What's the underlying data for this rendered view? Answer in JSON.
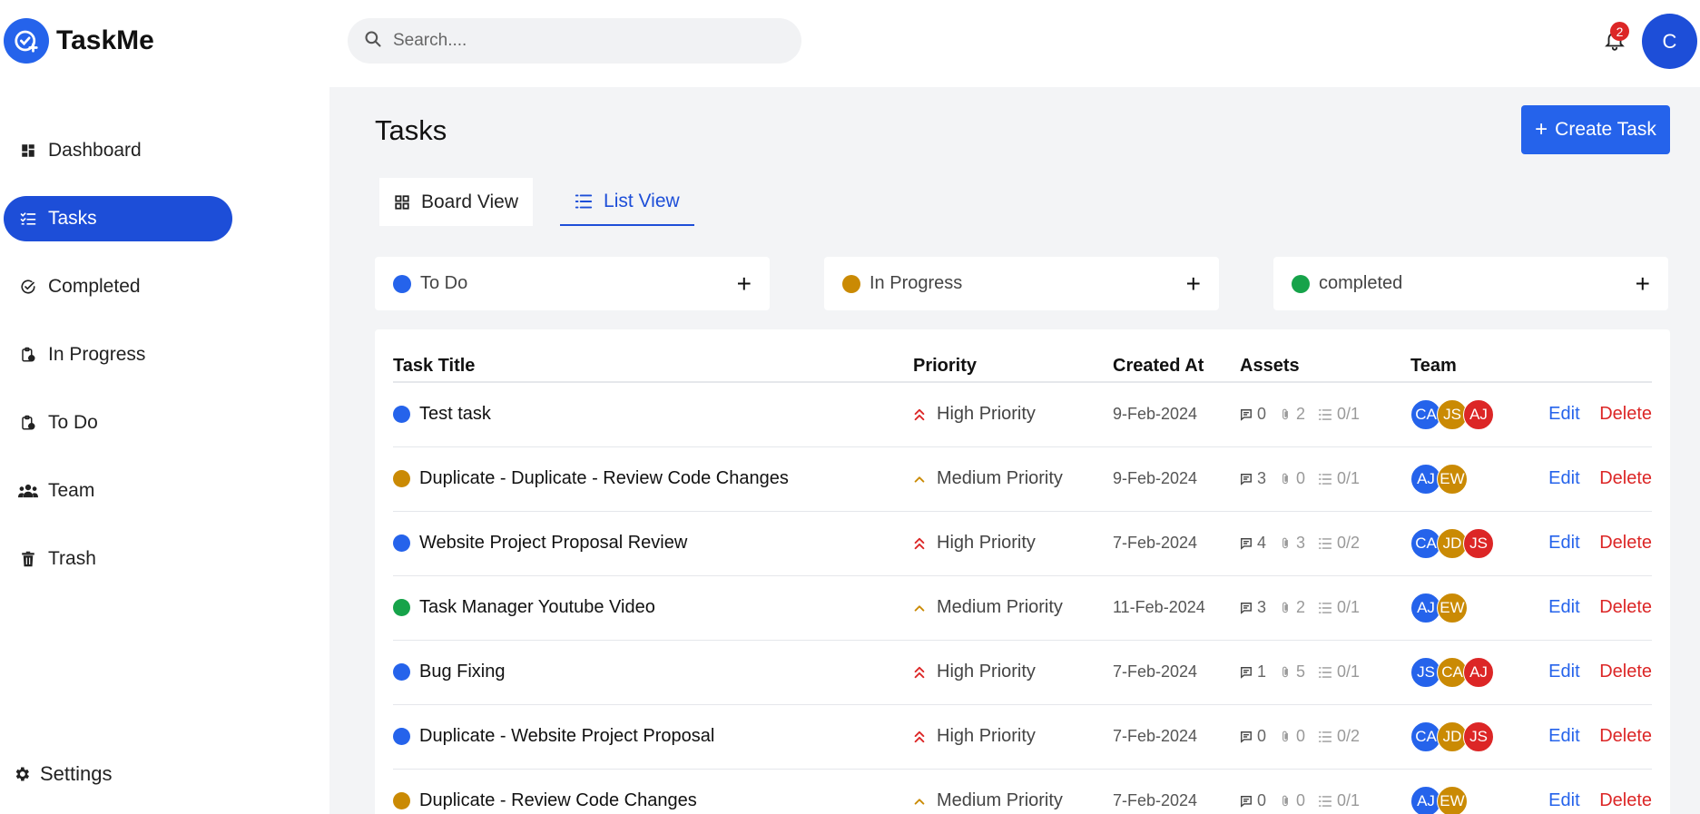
{
  "app": {
    "name": "TaskMe"
  },
  "sidebar": {
    "items": [
      {
        "label": "Dashboard",
        "icon": "dashboard-icon",
        "active": false
      },
      {
        "label": "Tasks",
        "icon": "tasks-icon",
        "active": true
      },
      {
        "label": "Completed",
        "icon": "check-circle-icon",
        "active": false
      },
      {
        "label": "In Progress",
        "icon": "clipboard-progress-icon",
        "active": false
      },
      {
        "label": "To Do",
        "icon": "clipboard-todo-icon",
        "active": false
      },
      {
        "label": "Team",
        "icon": "team-icon",
        "active": false
      },
      {
        "label": "Trash",
        "icon": "trash-icon",
        "active": false
      }
    ],
    "settings_label": "Settings"
  },
  "header": {
    "search_placeholder": "Search....",
    "notification_count": "2",
    "user_initial": "C"
  },
  "main": {
    "title": "Tasks",
    "create_label": "Create Task",
    "views": [
      {
        "label": "Board View",
        "active": false
      },
      {
        "label": "List View",
        "active": true
      }
    ],
    "stages": [
      {
        "label": "To Do",
        "color": "#2563eb"
      },
      {
        "label": "In Progress",
        "color": "#ca8a04"
      },
      {
        "label": "completed",
        "color": "#16a34a"
      }
    ],
    "table": {
      "headers": [
        "Task Title",
        "Priority",
        "Created At",
        "Assets",
        "Team"
      ],
      "edit_label": "Edit",
      "delete_label": "Delete",
      "rows": [
        {
          "title": "Test task",
          "stage_color": "#2563eb",
          "priority": "High Priority",
          "priority_level": "high",
          "date": "9-Feb-2024",
          "comments": "0",
          "attachments": "2",
          "subtasks": "0/1",
          "team": [
            "CA",
            "JS",
            "AJ"
          ]
        },
        {
          "title": "Duplicate - Duplicate - Review Code Changes",
          "stage_color": "#ca8a04",
          "priority": "Medium Priority",
          "priority_level": "medium",
          "date": "9-Feb-2024",
          "comments": "3",
          "attachments": "0",
          "subtasks": "0/1",
          "team": [
            "AJ",
            "EW"
          ]
        },
        {
          "title": "Website Project Proposal Review",
          "stage_color": "#2563eb",
          "priority": "High Priority",
          "priority_level": "high",
          "date": "7-Feb-2024",
          "comments": "4",
          "attachments": "3",
          "subtasks": "0/2",
          "team": [
            "CA",
            "JD",
            "JS"
          ]
        },
        {
          "title": "Task Manager Youtube Video",
          "stage_color": "#16a34a",
          "priority": "Medium Priority",
          "priority_level": "medium",
          "date": "11-Feb-2024",
          "comments": "3",
          "attachments": "2",
          "subtasks": "0/1",
          "team": [
            "AJ",
            "EW"
          ]
        },
        {
          "title": "Bug Fixing",
          "stage_color": "#2563eb",
          "priority": "High Priority",
          "priority_level": "high",
          "date": "7-Feb-2024",
          "comments": "1",
          "attachments": "5",
          "subtasks": "0/1",
          "team": [
            "JS",
            "CA",
            "AJ"
          ]
        },
        {
          "title": "Duplicate - Website Project Proposal",
          "stage_color": "#2563eb",
          "priority": "High Priority",
          "priority_level": "high",
          "date": "7-Feb-2024",
          "comments": "0",
          "attachments": "0",
          "subtasks": "0/2",
          "team": [
            "CA",
            "JD",
            "JS"
          ]
        },
        {
          "title": "Duplicate - Review Code Changes",
          "stage_color": "#ca8a04",
          "priority": "Medium Priority",
          "priority_level": "medium",
          "date": "7-Feb-2024",
          "comments": "0",
          "attachments": "0",
          "subtasks": "0/1",
          "team": [
            "AJ",
            "EW"
          ]
        }
      ]
    }
  },
  "colors": {
    "accent": "#2563eb",
    "avatar_palette": [
      "#2563eb",
      "#ca8a04",
      "#dc2626"
    ]
  }
}
